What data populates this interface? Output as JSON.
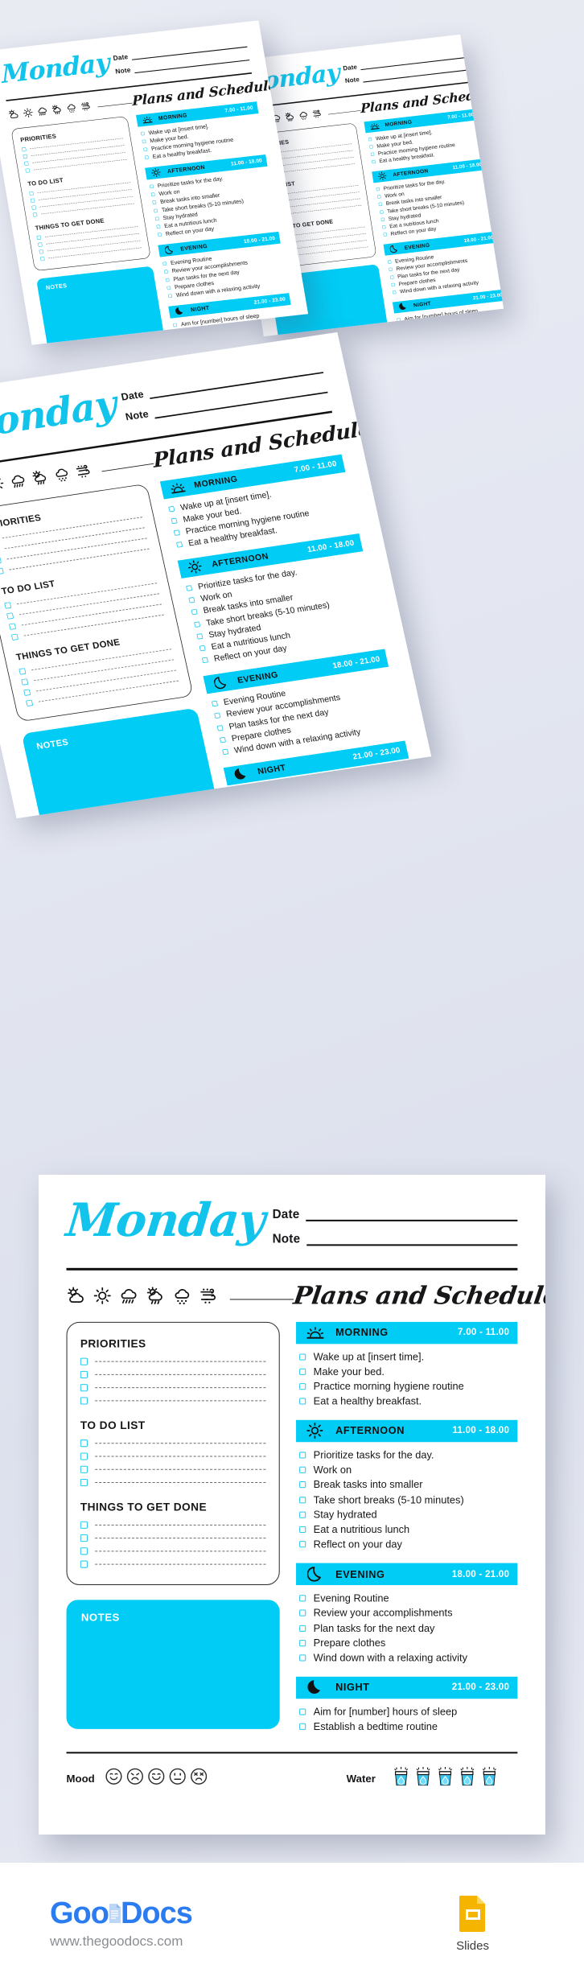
{
  "background": {
    "color": "#e8eaf2"
  },
  "brand": {
    "accent": "#00ccf5",
    "title_color": "#12c4ec"
  },
  "planner": {
    "day_title": "Monday",
    "fields": [
      {
        "label": "Date"
      },
      {
        "label": "Note"
      }
    ],
    "weather_icons": [
      "sun-behind-cloud-icon",
      "sun-icon",
      "cloud-rain-icon",
      "sun-behind-rain-cloud-icon",
      "cloud-snow-icon",
      "wind-snow-icon"
    ],
    "plans_title": "Plans and Schedules",
    "left_sections": [
      {
        "title": "PRIORITIES",
        "rows": 4
      },
      {
        "title": "TO DO LIST",
        "rows": 4
      },
      {
        "title": "THINGS TO GET DONE",
        "rows": 4
      }
    ],
    "notes_label": "NOTES",
    "schedule": [
      {
        "icon": "sunrise-icon",
        "name": "MORNING",
        "time": "7.00 - 11.00",
        "items": [
          "Wake up at [insert time].",
          "Make your bed.",
          "Practice morning hygiene routine",
          "Eat a healthy breakfast."
        ]
      },
      {
        "icon": "sun-icon",
        "name": "AFTERNOON",
        "time": "11.00 - 18.00",
        "items": [
          "Prioritize tasks for the day.",
          "Work on",
          "Break tasks into smaller",
          "Take short breaks (5-10 minutes)",
          "Stay hydrated",
          "Eat a nutritious lunch",
          "Reflect on your day"
        ]
      },
      {
        "icon": "crescent-moon-outline-icon",
        "name": "EVENING",
        "time": "18.00 - 21.00",
        "items": [
          "Evening Routine",
          "Review your accomplishments",
          "Plan tasks for the next day",
          "Prepare clothes",
          "Wind down with a relaxing activity"
        ]
      },
      {
        "icon": "crescent-moon-filled-icon",
        "name": "NIGHT",
        "time": "21.00 - 23.00",
        "items": [
          "Aim for [number] hours of sleep",
          "Establish a bedtime routine"
        ]
      }
    ],
    "footer": {
      "mood_label": "Mood",
      "mood_icons": [
        "smile-face-icon",
        "sad-face-icon",
        "happy-face-icon",
        "neutral-face-icon",
        "angry-face-icon"
      ],
      "water_label": "Water",
      "water_glass_count": 5
    }
  },
  "goodocs": {
    "logo_goo": "Goo",
    "logo_docs": "Docs",
    "url": "www.thegoodocs.com",
    "slides_label": "Slides",
    "slides_color": "#f4b400"
  }
}
